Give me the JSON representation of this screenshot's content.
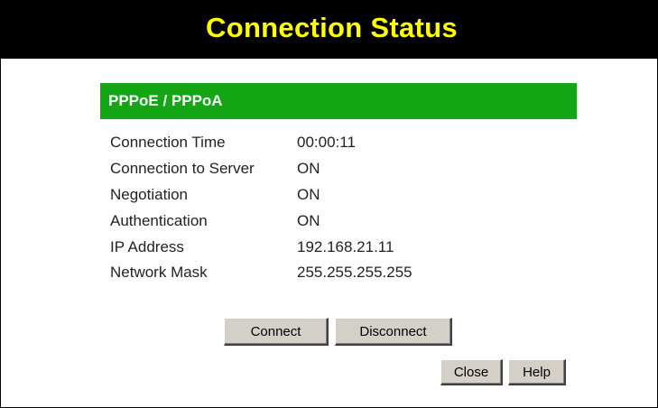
{
  "header": {
    "title": "Connection Status"
  },
  "section": {
    "title": "PPPoE / PPPoA"
  },
  "info_rows": [
    {
      "label": "Connection Time",
      "value": "00:00:11"
    },
    {
      "label": "Connection to Server",
      "value": "ON"
    },
    {
      "label": "Negotiation",
      "value": "ON"
    },
    {
      "label": "Authentication",
      "value": "ON"
    },
    {
      "label": "IP Address",
      "value": "192.168.21.11"
    },
    {
      "label": "Network Mask",
      "value": "255.255.255.255"
    }
  ],
  "buttons": {
    "connect": "Connect",
    "disconnect": "Disconnect",
    "close": "Close",
    "help": "Help"
  },
  "colors": {
    "title_bg": "#000000",
    "title_text": "#ffff00",
    "section_bg": "#15a615",
    "section_text": "#ffffff"
  }
}
